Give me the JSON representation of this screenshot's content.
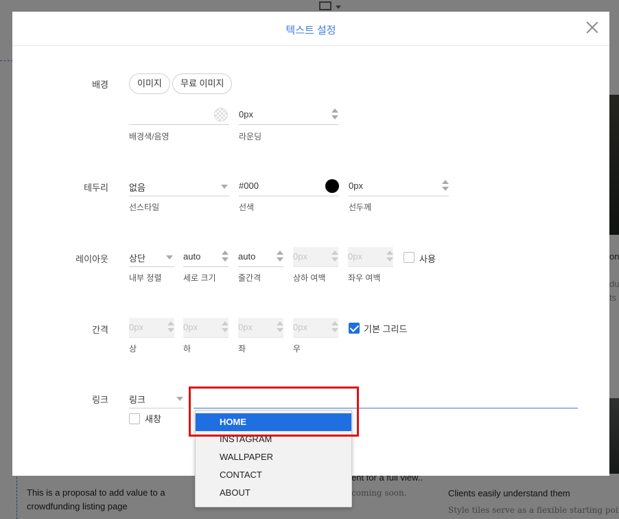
{
  "background": {
    "left_text_1": "This is a proposal to add value to a",
    "left_text_2": "crowdfunding listing page",
    "mid_text_1": "ent for a full view..",
    "mid_text_2": "coming soon.",
    "right_text_1": "Clients easily understand them",
    "right_text_2": "Style tiles serve as a flexible starting point th",
    "side_text_1": "on v",
    "side_text_2": "du",
    "side_text_3": "ts t"
  },
  "modal": {
    "title": "텍스트 설정",
    "background_section": {
      "label": "배경",
      "image_button": "이미지",
      "free_image_button": "무료 이미지",
      "bg_color_value": "",
      "bg_color_label": "배경색/음영",
      "rounding_value": "0px",
      "rounding_label": "라운딩"
    },
    "border_section": {
      "label": "테두리",
      "line_style_value": "없음",
      "line_style_label": "선스타일",
      "line_color_value": "#000",
      "line_color_label": "선색",
      "line_color_swatch": "#000000",
      "line_width_value": "0px",
      "line_width_label": "선두께"
    },
    "layout_section": {
      "label": "레이아웃",
      "align_value": "상단",
      "align_label": "내부 정렬",
      "height_value": "auto",
      "height_label": "세로 크기",
      "line_gap_value": "auto",
      "line_gap_label": "줄간격",
      "vpad_value": "0px",
      "vpad_label": "상하 여백",
      "hpad_value": "0px",
      "hpad_label": "좌우 여백",
      "use_label": "사용",
      "use_checked": false
    },
    "spacing_section": {
      "label": "간격",
      "top_value": "0px",
      "top_label": "상",
      "bottom_value": "0px",
      "bottom_label": "하",
      "left_value": "0px",
      "left_label": "좌",
      "right_value": "0px",
      "right_label": "우",
      "default_grid_label": "기본 그리드",
      "default_grid_checked": true
    },
    "link_section": {
      "label": "링크",
      "type_value": "링크",
      "new_window_label": "새창",
      "new_window_checked": false,
      "dropdown_options": [
        "HOME",
        "INSTAGRAM",
        "WALLPAPER",
        "CONTACT",
        "ABOUT"
      ],
      "selected_option": "HOME"
    }
  },
  "colors": {
    "accent": "#1f6fe0",
    "title": "#3d7be0",
    "highlight": "#e01010"
  }
}
